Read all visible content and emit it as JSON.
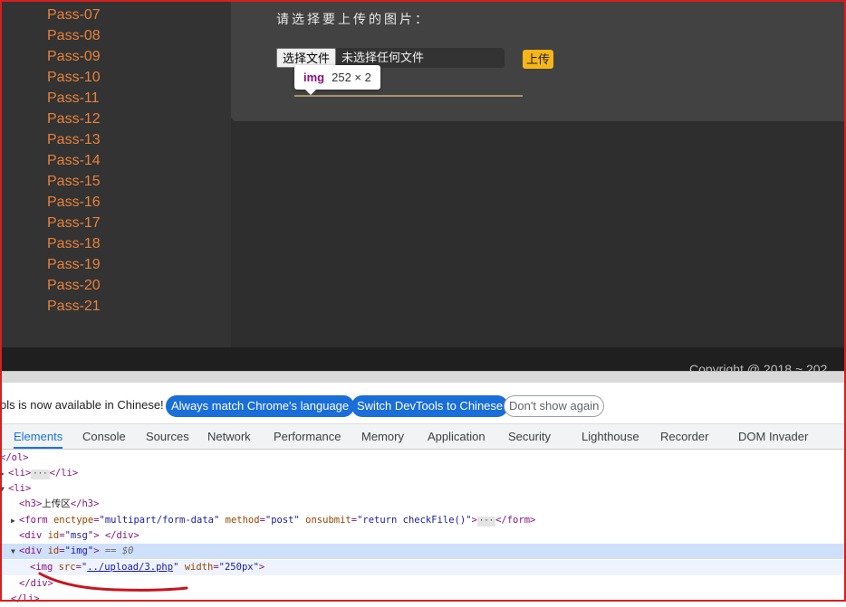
{
  "page": {
    "pass_items": [
      "Pass-07",
      "Pass-08",
      "Pass-09",
      "Pass-10",
      "Pass-11",
      "Pass-12",
      "Pass-13",
      "Pass-14",
      "Pass-15",
      "Pass-16",
      "Pass-17",
      "Pass-18",
      "Pass-19",
      "Pass-20",
      "Pass-21"
    ],
    "prompt": "请选择要上传的图片：",
    "file_button": "选择文件",
    "file_status": "未选择任何文件",
    "upload_button": "上传",
    "tooltip": {
      "tag": "img",
      "dims": "252 × 2"
    },
    "copyright": "Copyright @ 2018 ~ 202"
  },
  "devtools": {
    "info_text": "ols is now available in Chinese!",
    "btn_match": "Always match Chrome's language",
    "btn_switch": "Switch DevTools to Chinese",
    "btn_dont_show": "Don't show again",
    "tabs": [
      "Elements",
      "Console",
      "Sources",
      "Network",
      "Performance",
      "Memory",
      "Application",
      "Security",
      "Lighthouse",
      "Recorder",
      "DOM Invader"
    ],
    "active_tab": "Elements",
    "dom": {
      "ol_close": "ol>",
      "h3_text": "上传区",
      "form_enctype": "\"multipart/form-data\"",
      "form_method": "\"post\"",
      "form_onsubmit": "\"return checkFile()\"",
      "div_msg_id": "\"msg\"",
      "div_img_id": "\"img\"",
      "selected_marker": "== $0",
      "img_src": "../upload/3.php",
      "img_width": "\"250px\""
    }
  },
  "colors": {
    "pass_link": "#e8823c",
    "upload_btn": "#f7b617",
    "annotation": "#c8141e",
    "devtools_accent": "#1a73e8"
  }
}
